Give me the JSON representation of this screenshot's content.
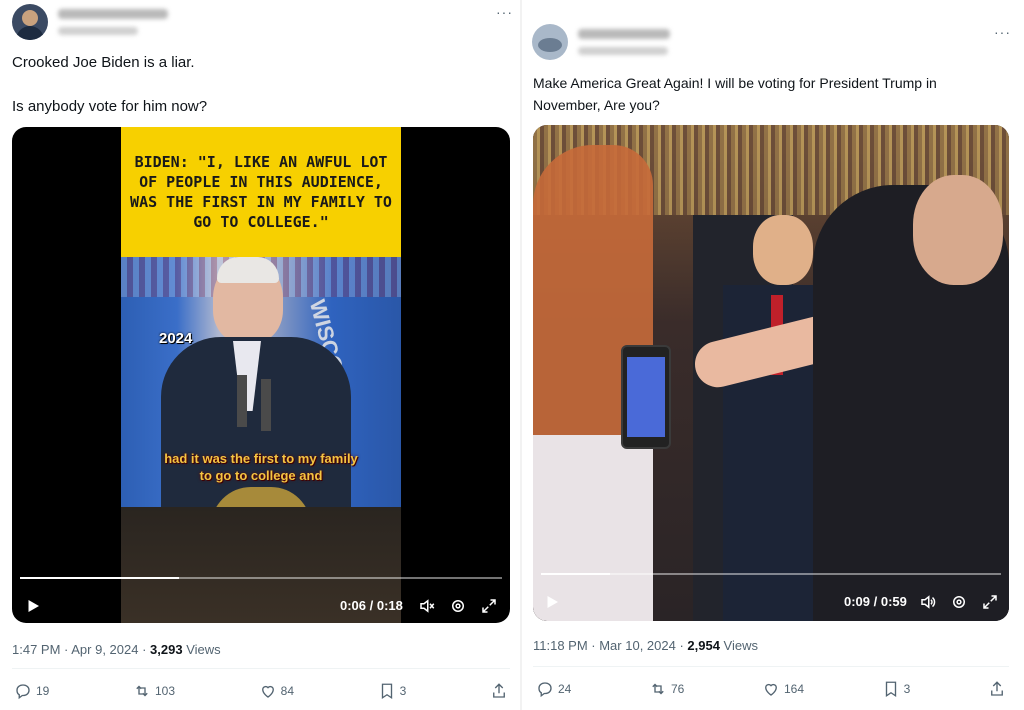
{
  "left": {
    "text": "Crooked Joe Biden is a liar.\n\nIs anybody vote for him now?",
    "caption": "BIDEN: \"I, LIKE AN AWFUL LOT OF PEOPLE IN THIS AUDIENCE, WAS THE FIRST IN MY FAMILY TO GO TO COLLEGE.\"",
    "year": "2024",
    "subtitle_line1": "had it was the first to my family",
    "subtitle_line2": "to go to college and",
    "flag_text": "WISCO",
    "time": "0:06 / 0:18",
    "progress": 0.33,
    "timestamp": "1:47 PM · Apr 9, 2024 · ",
    "views_count": "3,293",
    "views_label": " Views",
    "replies": "19",
    "reposts": "103",
    "likes": "84",
    "bookmarks": "3"
  },
  "right": {
    "text": "Make America Great Again! I will be voting for President Trump in November, Are you?",
    "time": "0:09 / 0:59",
    "progress": 0.15,
    "timestamp": "11:18 PM · Mar 10, 2024 · ",
    "views_count": "2,954",
    "views_label": " Views",
    "replies": "24",
    "reposts": "76",
    "likes": "164",
    "bookmarks": "3"
  },
  "more_label": "···",
  "colors": {
    "caption_bg": "#f7d000",
    "link_gray": "#536471",
    "text": "#0f1419"
  },
  "icons": [
    "reply-icon",
    "repost-icon",
    "like-icon",
    "bookmark-icon",
    "share-icon",
    "play-icon",
    "volume-icon",
    "settings-icon",
    "fullscreen-icon"
  ]
}
